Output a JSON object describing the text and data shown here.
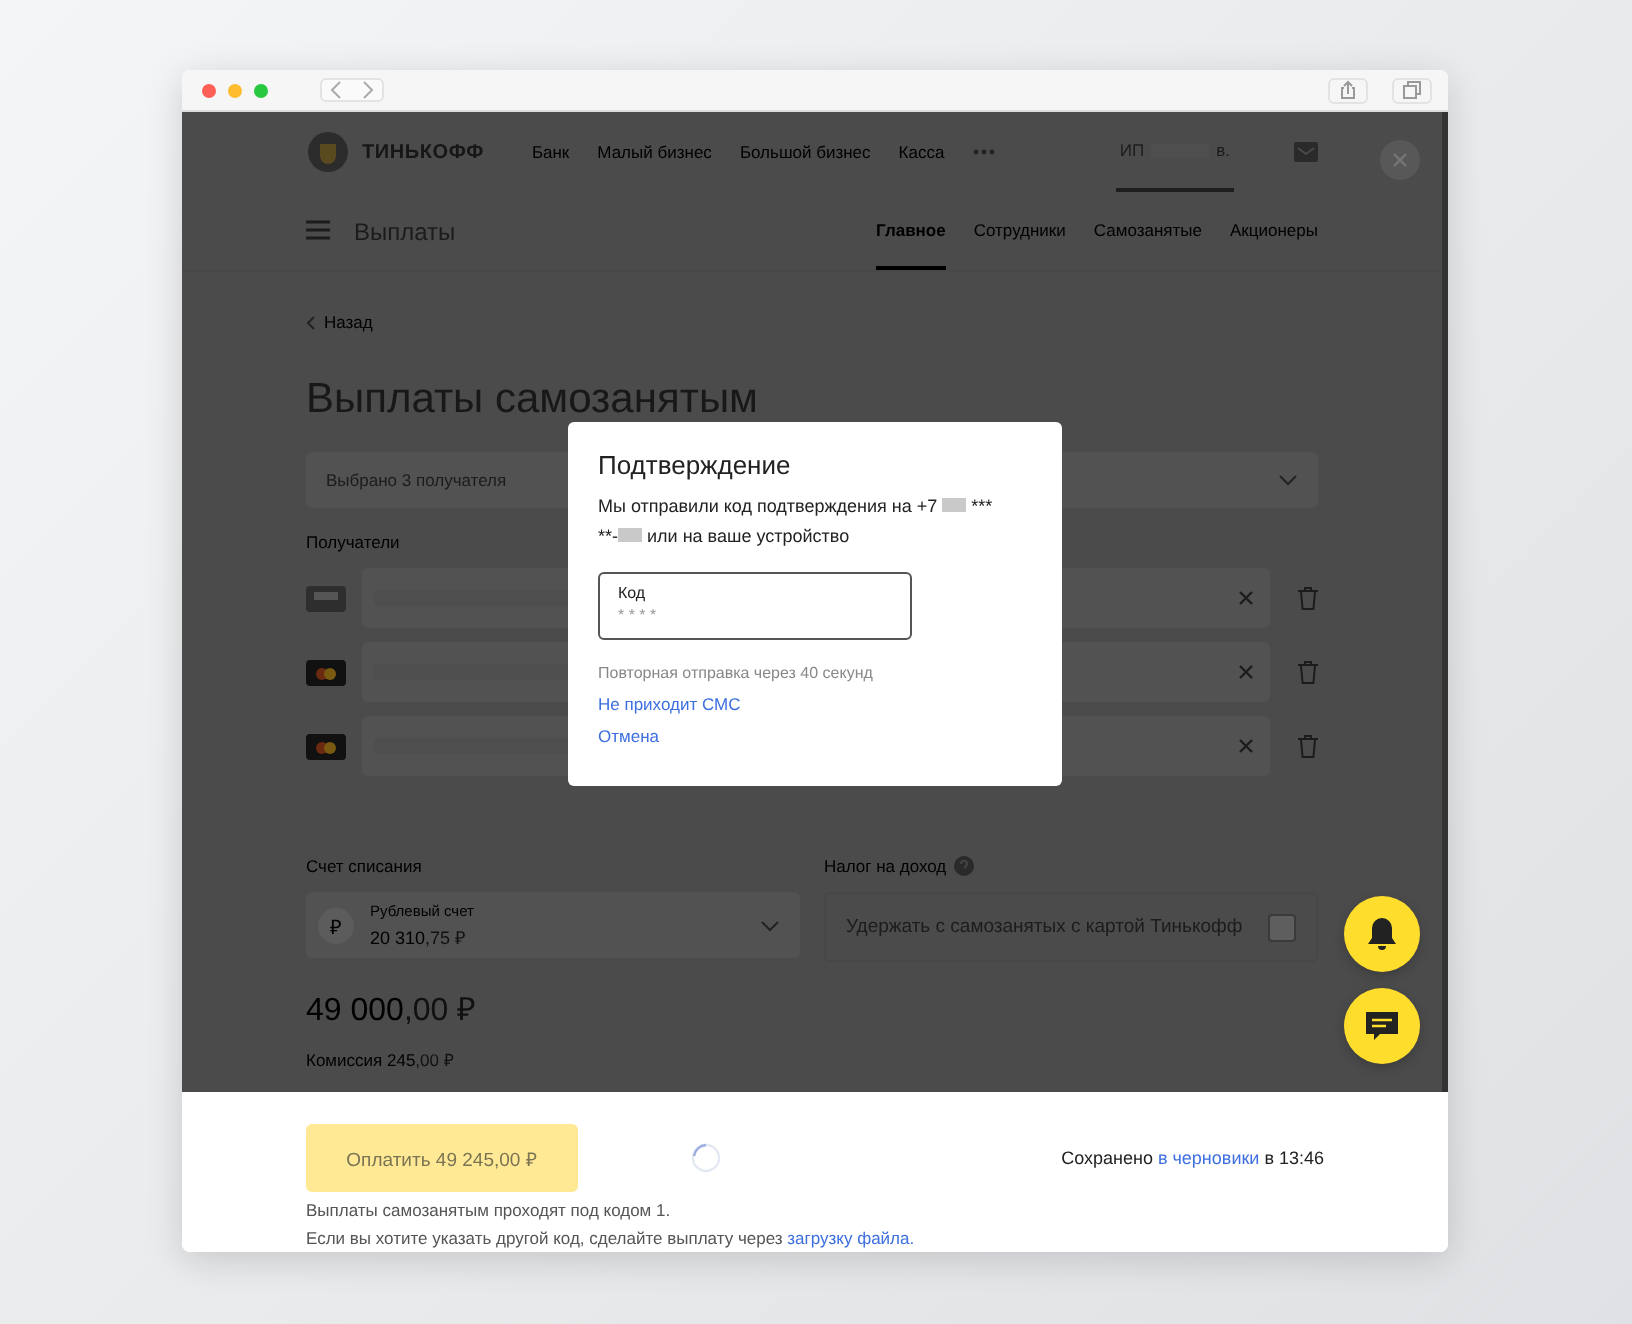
{
  "header": {
    "logo": "ТИНЬКОФФ",
    "nav": [
      "Банк",
      "Малый бизнес",
      "Большой бизнес",
      "Касса"
    ],
    "account": {
      "prefix": "ИП",
      "suffix": "в."
    }
  },
  "subheader": {
    "title": "Выплаты",
    "tabs": [
      {
        "label": "Главное",
        "selected": true
      },
      {
        "label": "Сотрудники",
        "selected": false
      },
      {
        "label": "Самозанятые",
        "selected": false
      },
      {
        "label": "Акционеры",
        "selected": false
      }
    ]
  },
  "back": "Назад",
  "title": "Выплаты самозанятым",
  "recipients_select": "Выбрано 3 получателя",
  "recipients_label": "Получатели",
  "recipients": [
    {
      "kind": "plain"
    },
    {
      "kind": "mastercard"
    },
    {
      "kind": "mastercard"
    }
  ],
  "account": {
    "label": "Счет списания",
    "icon": "₽",
    "name": "Рублевый счет",
    "balance": "20 310",
    "balance_fraction": ",75 ₽"
  },
  "tax": {
    "label": "Налог на доход",
    "option": "Удержать с самозанятых с картой Тинькофф",
    "checked": false
  },
  "total": {
    "whole": "49 000",
    "fraction": ",00 ₽"
  },
  "commission": {
    "whole": "Комиссия 245",
    "fraction": ",00 ₽"
  },
  "footer": {
    "pay_button": "Оплатить 49 245,00 ₽",
    "saved": {
      "before": "Сохранено",
      "link": "в черновики",
      "after": "в 13:46"
    },
    "note": "Выплаты самозанятым проходят под кодом 1.",
    "note2": {
      "text": "Если вы хотите указать другой код, сделайте выплату через",
      "link": "загрузку файла."
    }
  },
  "modal": {
    "title": "Подтверждение",
    "message": [
      "Мы отправили код подтверждения на +7",
      "***",
      "**-",
      "или на ваше устройство"
    ],
    "field": {
      "label": "Код",
      "placeholder": "* * * *"
    },
    "resend": "Повторная отправка через 40 секунд",
    "links": [
      "Не приходит СМС",
      "Отмена"
    ]
  }
}
